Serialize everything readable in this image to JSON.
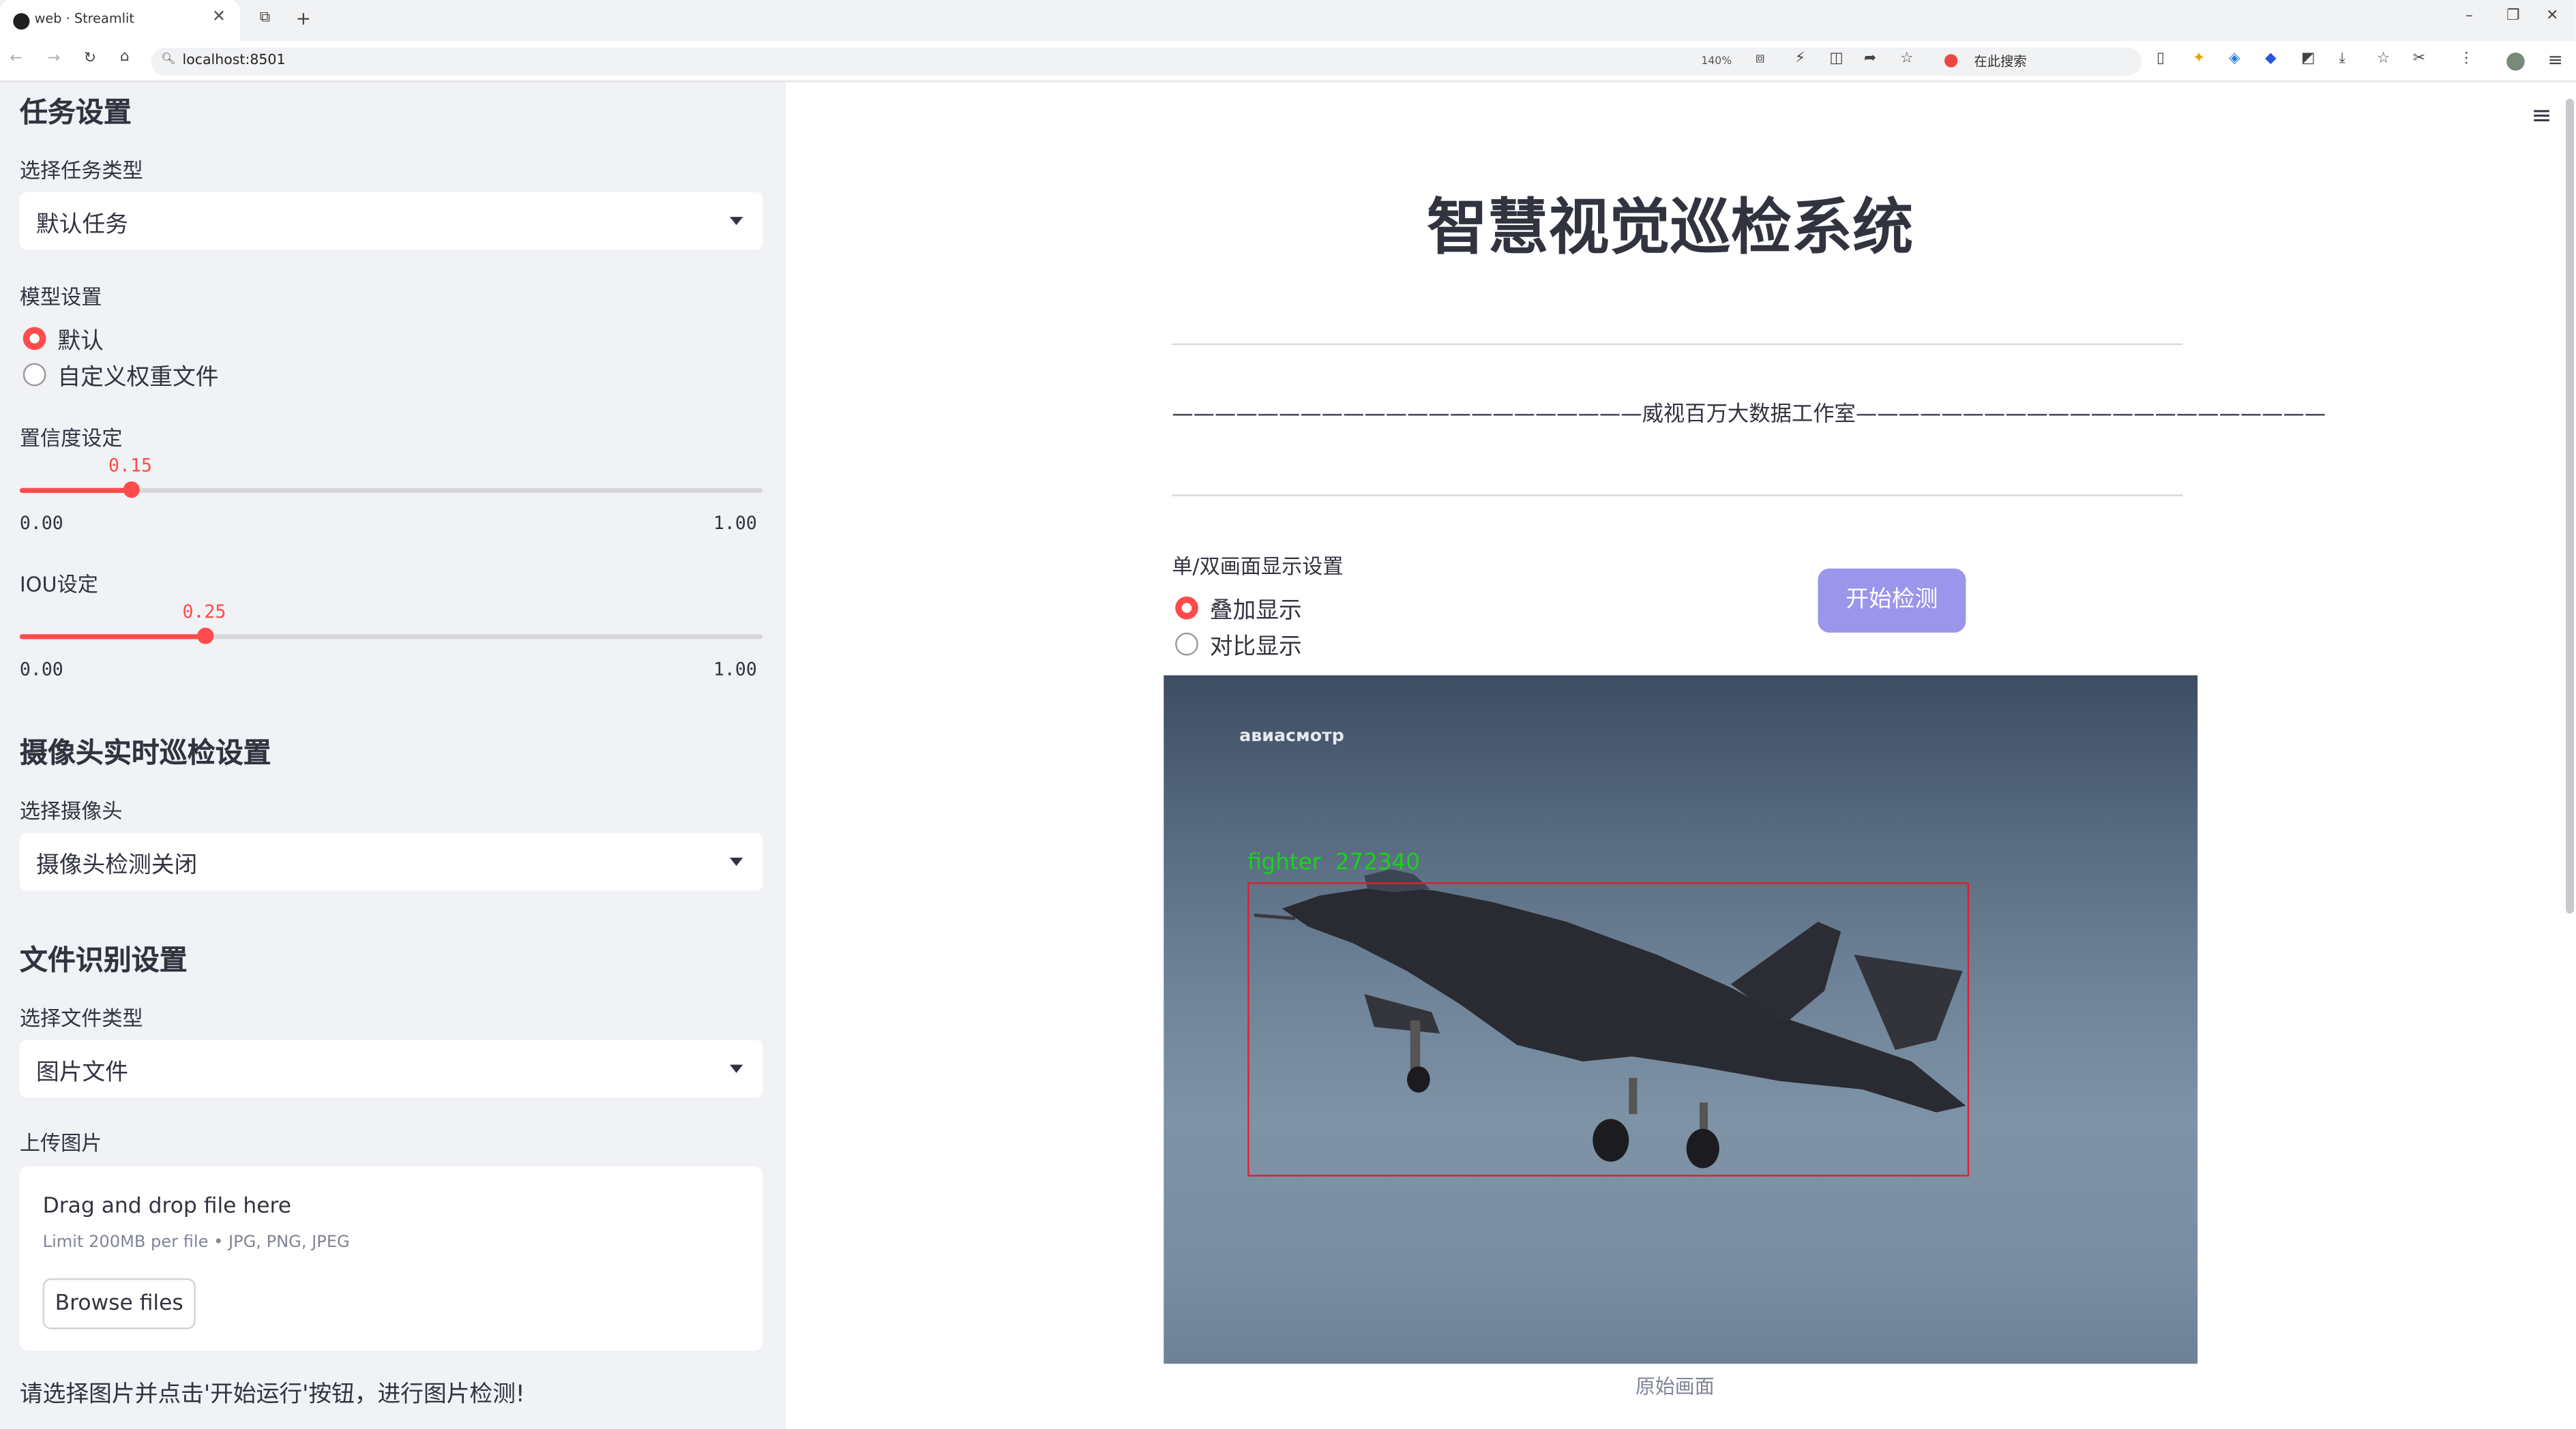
{
  "browser": {
    "tab_title": "web · Streamlit",
    "url": "localhost:8501",
    "zoom": "140%",
    "search_text": "在此搜索"
  },
  "sidebar": {
    "task_header": "任务设置",
    "task_type_label": "选择任务类型",
    "task_type_value": "默认任务",
    "model_label": "模型设置",
    "model_options": [
      "默认",
      "自定义权重文件"
    ],
    "model_selected": "默认",
    "confidence_label": "置信度设定",
    "confidence_value": "0.15",
    "confidence_min": "0.00",
    "confidence_max": "1.00",
    "iou_label": "IOU设定",
    "iou_value": "0.25",
    "iou_min": "0.00",
    "iou_max": "1.00",
    "camera_header": "摄像头实时巡检设置",
    "camera_label": "选择摄像头",
    "camera_value": "摄像头检测关闭",
    "file_header": "文件识别设置",
    "file_type_label": "选择文件类型",
    "file_type_value": "图片文件",
    "upload_label": "上传图片",
    "upload_drop_text": "Drag and drop file here",
    "upload_limit_text": "Limit 200MB per file • JPG, PNG, JPEG",
    "browse_button": "Browse files",
    "hint_text": "请选择图片并点击'开始运行'按钮，进行图片检测!"
  },
  "main": {
    "title": "智慧视觉巡检系统",
    "subtitle": "——————————————————————威视百万大数据工作室——————————————————————",
    "display_label": "单/双画面显示设置",
    "display_options": [
      "叠加显示",
      "对比显示"
    ],
    "display_selected": "叠加显示",
    "start_button": "开始检测",
    "image_watermark": "авиасмотр",
    "detection_label": "fighter  272340",
    "image_caption": "原始画面"
  },
  "colors": {
    "accent": "#ff4b4b",
    "button_primary": "#9b95eb",
    "sidebar_bg": "#f0f2f6",
    "detection_box": "#e0202a",
    "detection_text": "#19d119"
  },
  "icons": [
    "back-icon",
    "forward-icon",
    "reload-icon",
    "home-icon",
    "menu-icon",
    "caret-down-icon"
  ]
}
